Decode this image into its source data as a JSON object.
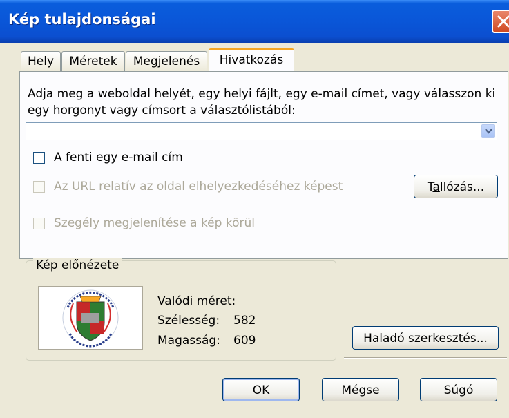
{
  "window": {
    "title": "Kép tulajdonságai"
  },
  "tabs": [
    {
      "label": "Hely",
      "active": false
    },
    {
      "label": "Méretek",
      "active": false
    },
    {
      "label": "Megjelenés",
      "active": false
    },
    {
      "label": "Hivatkozás",
      "active": true
    }
  ],
  "link": {
    "description": "Adja meg a weboldal helyét, egy helyi fájlt, egy e-mail címet, vagy válasszon ki egy horgonyt vagy címsort a választólistából:",
    "url_value": "",
    "email_checkbox": {
      "label": "A fenti egy e-mail cím",
      "checked": false,
      "enabled": true
    },
    "relative_checkbox": {
      "label": "Az URL relatív az oldal elhelyezkedéséhez képest",
      "checked": false,
      "enabled": false
    },
    "border_checkbox": {
      "label": "Szegély megjelenítése a kép körül",
      "checked": false,
      "enabled": false
    },
    "browse_button": {
      "prefix": "T",
      "underline": "a",
      "suffix": "llózás..."
    }
  },
  "preview": {
    "legend": "Kép előnézete",
    "real_size_label": "Valódi méret:",
    "width_label": "Szélesség:",
    "width_value": "582",
    "height_label": "Magasság:",
    "height_value": "609"
  },
  "advanced_button": {
    "underline": "H",
    "suffix": "aladó szerkesztés..."
  },
  "footer": {
    "ok_label": "OK",
    "cancel_label": "Mégse",
    "help_button": {
      "underline": "S",
      "suffix": "úgó"
    }
  },
  "colors": {
    "titlebar": "#0a56d8",
    "dialog_bg": "#ece9d8",
    "tab_highlight": "#f5a623",
    "disabled_text": "#aca899"
  }
}
